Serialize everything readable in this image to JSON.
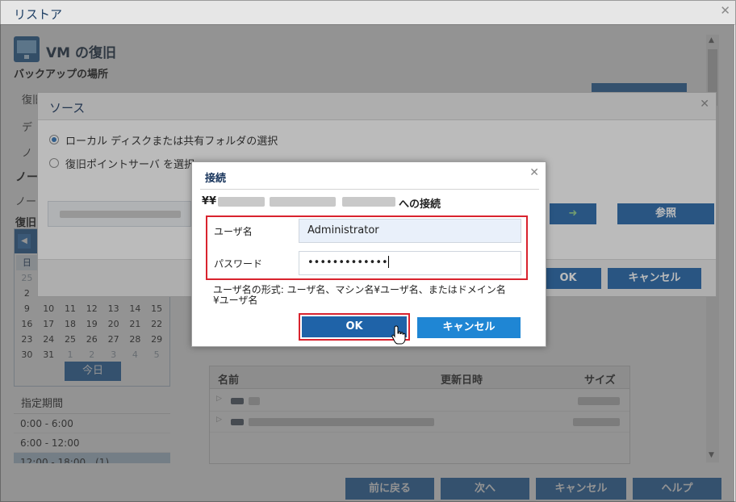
{
  "window": {
    "title": "リストア"
  },
  "page": {
    "vm_title": "VM の復旧",
    "backup_location_label": "バックアップの場所",
    "bg_fragment_1": "復旧",
    "bg_fragment_2": "デ",
    "bg_fragment_3": "ノ",
    "bg_fragment_4": "ノー",
    "bg_fragment_5": "ノー",
    "bg_fragment_6": "復旧"
  },
  "calendar": {
    "rows": [
      [
        "日",
        "",
        "",
        "",
        "",
        "",
        ""
      ],
      [
        "25",
        "",
        "",
        "",
        "",
        "",
        ""
      ],
      [
        "2",
        "",
        "",
        "",
        "",
        "",
        ""
      ],
      [
        "9",
        "10",
        "11",
        "12",
        "13",
        "14",
        "15"
      ],
      [
        "16",
        "17",
        "18",
        "19",
        "20",
        "21",
        "22"
      ],
      [
        "23",
        "24",
        "25",
        "26",
        "27",
        "28",
        "29"
      ],
      [
        "30",
        "31",
        "1",
        "2",
        "3",
        "4",
        "5"
      ]
    ],
    "today_label": "今日"
  },
  "period": {
    "label": "指定期間",
    "items": [
      "0:00 - 6:00",
      "6:00 - 12:00",
      "12:00 - 18:00　(1)"
    ]
  },
  "file_table": {
    "headers": {
      "name": "名前",
      "modified": "更新日時",
      "size": "サイズ"
    }
  },
  "footer": {
    "back": "前に戻る",
    "next": "次へ",
    "cancel": "キャンセル",
    "help": "ヘルプ"
  },
  "source_dialog": {
    "title": "ソース",
    "option_local": "ローカル ディスクまたは共有フォルダの選択",
    "option_rps": "復旧ポイントサーバ を選択",
    "browse": "参照",
    "ok": "OK",
    "cancel": "キャンセル"
  },
  "connect_dialog": {
    "title": "接続",
    "heading_prefix": "¥¥",
    "heading_suffix": "への接続",
    "username_label": "ユーザ名",
    "username_value": "Administrator",
    "password_label": "パスワード",
    "password_value": "•••••••••••••",
    "hint": "ユーザ名の形式: ユーザ名、マシン名¥ユーザ名、またはドメイン名¥ユーザ名",
    "ok": "OK",
    "cancel": "キャンセル"
  },
  "icons": {
    "close": "close-icon",
    "vm": "vm-restore-icon",
    "prev": "chevron-left-icon",
    "expand": "expand-triangle-icon",
    "drive": "drive-icon",
    "cursor": "hand-pointer-icon"
  }
}
